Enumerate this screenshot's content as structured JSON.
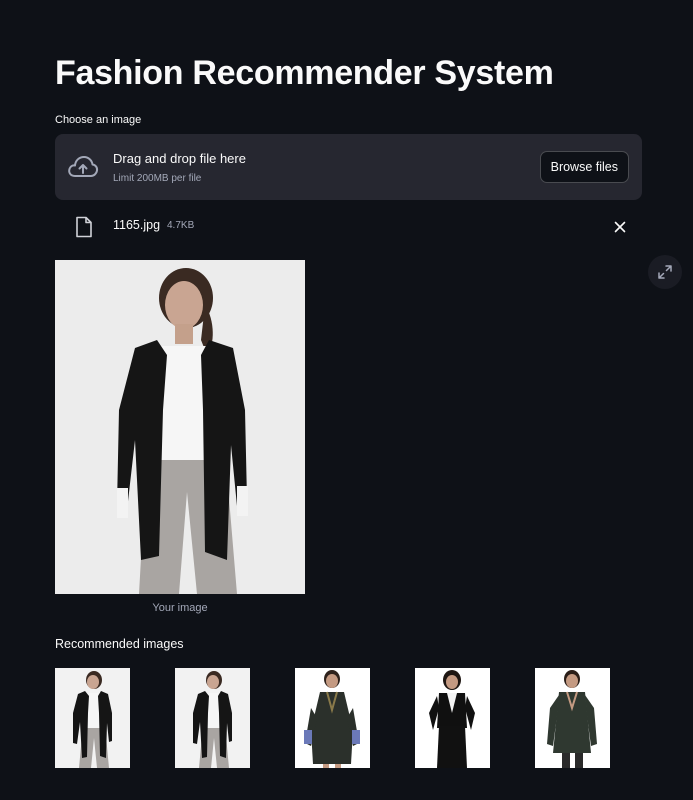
{
  "page": {
    "title": "Fashion Recommender System"
  },
  "uploader": {
    "label": "Choose an image",
    "drop_text": "Drag and drop file here",
    "limit_text": "Limit 200MB per file",
    "browse_label": "Browse files",
    "icon": "cloud-upload-icon"
  },
  "uploaded_file": {
    "name": "1165.jpg",
    "size": "4.7KB",
    "icon": "file-icon"
  },
  "main_image": {
    "caption": "Your image",
    "garment": "black-cardigan"
  },
  "recommendations": {
    "heading": "Recommended images",
    "items": [
      {
        "garment": "black-cardigan"
      },
      {
        "garment": "black-cardigan"
      },
      {
        "garment": "embellished-kurta"
      },
      {
        "garment": "black-waistcoat-top"
      },
      {
        "garment": "olive-v-neck-top"
      }
    ]
  },
  "colors": {
    "background": "#0e1117",
    "surface": "#262730",
    "text": "#fafafa",
    "muted": "#a3a8b8"
  }
}
